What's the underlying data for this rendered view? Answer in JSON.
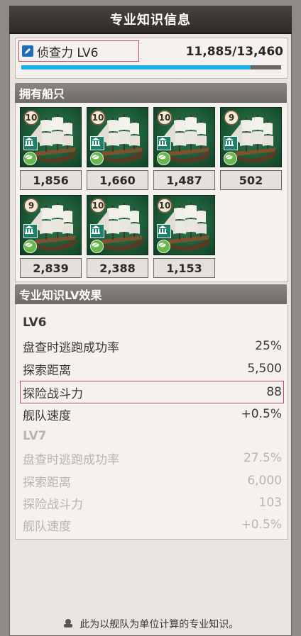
{
  "window": {
    "title": "专业知识信息"
  },
  "skill": {
    "icon": "pen-icon",
    "name": "侦查力 LV6",
    "xp_text": "11,885/13,460",
    "xp_fraction": 0.883
  },
  "ships_section": {
    "title": "拥有船只",
    "ships": [
      {
        "level": "10",
        "count": "1,856",
        "icons": [
          "bank-icon",
          "leaf-icon"
        ]
      },
      {
        "level": "10",
        "count": "1,660",
        "icons": [
          "bank-icon",
          "leaf-icon"
        ]
      },
      {
        "level": "10",
        "count": "1,487",
        "icons": [
          "bank-icon",
          "leaf-icon"
        ]
      },
      {
        "level": "9",
        "count": "502",
        "icons": [
          "bank-icon",
          "leaf-icon"
        ]
      },
      {
        "level": "9",
        "count": "2,839",
        "icons": [
          "bank-icon",
          "leaf-icon"
        ]
      },
      {
        "level": "10",
        "count": "2,388",
        "icons": [
          "bank-icon",
          "leaf-icon"
        ]
      },
      {
        "level": "10",
        "count": "1,153",
        "icons": [
          "bank-icon",
          "leaf-icon"
        ]
      }
    ]
  },
  "effects_section": {
    "title": "专业知识LV效果",
    "current": {
      "level_label": "LV6",
      "rows": [
        {
          "label": "盘查时逃跑成功率",
          "value": "25%"
        },
        {
          "label": "探索距离",
          "value": "5,500"
        },
        {
          "label": "探险战斗力",
          "value": "88"
        },
        {
          "label": "舰队速度",
          "value": "+0.5%"
        }
      ]
    },
    "next": {
      "level_label": "LV7",
      "rows": [
        {
          "label": "盘查时逃跑成功率",
          "value": "27.5%"
        },
        {
          "label": "探索距离",
          "value": "6,000"
        },
        {
          "label": "探险战斗力",
          "value": "103"
        },
        {
          "label": "舰队速度",
          "value": "+0.5%"
        }
      ]
    }
  },
  "footer": {
    "icon": "fleet-icon",
    "text": "此为以舰队为单位计算的专业知识。"
  },
  "colors": {
    "highlight": "#c24a57",
    "xp_bar": "#1aaee8",
    "ship_bg": "#1c5a37"
  }
}
